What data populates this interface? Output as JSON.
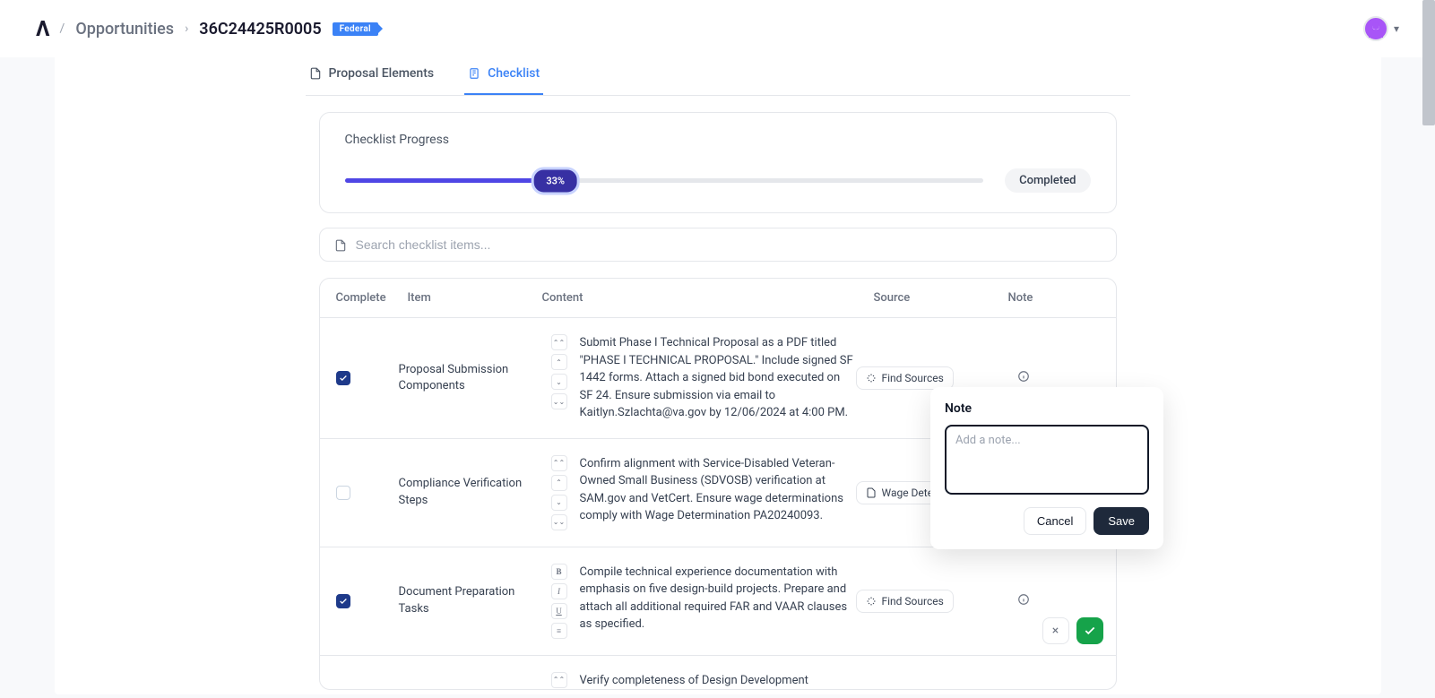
{
  "header": {
    "breadcrumb_root": "Opportunities",
    "breadcrumb_sep": "›",
    "opportunity_id": "36C24425R0005",
    "badge": "Federal"
  },
  "tabs": {
    "proposal_elements": "Proposal Elements",
    "checklist": "Checklist"
  },
  "progress": {
    "title": "Checklist Progress",
    "percent_label": "33%",
    "percent_value": 33,
    "completed_label": "Completed"
  },
  "search": {
    "placeholder": "Search checklist items..."
  },
  "columns": {
    "complete": "Complete",
    "item": "Item",
    "content": "Content",
    "source": "Source",
    "note": "Note"
  },
  "rows": [
    {
      "checked": true,
      "item": "Proposal Submission Components",
      "content": "Submit Phase I Technical Proposal as a PDF titled \"PHASE I TECHNICAL PROPOSAL.\" Include signed SF 1442 forms. Attach a signed bid bond executed on SF 24. Ensure submission via email to Kaitlyn.Szlachta@va.gov by 12/06/2024 at 4:00 PM.",
      "source_button": "Find Sources"
    },
    {
      "checked": false,
      "item": "Compliance Verification Steps",
      "content": "Confirm alignment with Service-Disabled Veteran-Owned Small Business (SDVOSB) verification at SAM.gov and VetCert. Ensure wage determinations comply with Wage Determination PA20240093.",
      "source_chip": "Wage Determinat"
    },
    {
      "checked": true,
      "item": "Document Preparation Tasks",
      "content": "Compile technical experience documentation with emphasis on five design-build projects. Prepare and attach all additional required FAR and VAAR clauses as specified.",
      "source_button": "Find Sources"
    },
    {
      "checked": false,
      "item": "",
      "content": "Verify completeness of Design Development"
    }
  ],
  "popover": {
    "title": "Note",
    "placeholder": "Add a note...",
    "cancel": "Cancel",
    "save": "Save"
  },
  "icons": {
    "file": "file-icon",
    "clipboard": "clipboard-icon",
    "sparkle": "sparkle-icon",
    "info": "info-icon"
  }
}
